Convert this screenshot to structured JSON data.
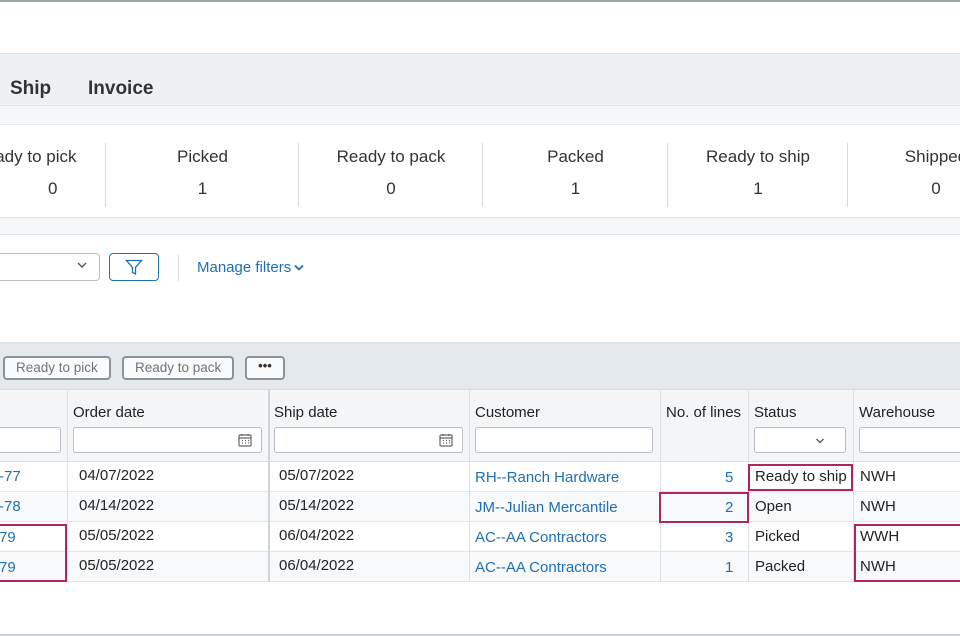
{
  "tabs": [
    "Ship",
    "Invoice"
  ],
  "stats": [
    {
      "label": "Ready to pick",
      "value": "0"
    },
    {
      "label": "Picked",
      "value": "1"
    },
    {
      "label": "Ready to pack",
      "value": "0"
    },
    {
      "label": "Packed",
      "value": "1"
    },
    {
      "label": "Ready to ship",
      "value": "1"
    },
    {
      "label": "Shipped",
      "value": "0"
    }
  ],
  "filters": {
    "manage_label": "Manage filters"
  },
  "actions": {
    "ready_to_pick": "Ready to pick",
    "ready_to_pack": "Ready to pack",
    "more": "•••"
  },
  "columns": {
    "order_date": "Order date",
    "ship_date": "Ship date",
    "customer": "Customer",
    "lines": "No. of lines",
    "status": "Status",
    "warehouse": "Warehouse"
  },
  "rows": [
    {
      "id": "-77",
      "order_date": "04/07/2022",
      "ship_date": "05/07/2022",
      "customer": "RH--Ranch Hardware",
      "lines": "5",
      "status": "Ready to ship",
      "warehouse": "NWH"
    },
    {
      "id": "-78",
      "order_date": "04/14/2022",
      "ship_date": "05/14/2022",
      "customer": "JM--Julian Mercantile",
      "lines": "2",
      "status": "Open",
      "warehouse": "NWH"
    },
    {
      "id": "79",
      "order_date": "05/05/2022",
      "ship_date": "06/04/2022",
      "customer": "AC--AA Contractors",
      "lines": "3",
      "status": "Picked",
      "warehouse": "WWH"
    },
    {
      "id": "79",
      "order_date": "05/05/2022",
      "ship_date": "06/04/2022",
      "customer": "AC--AA Contractors",
      "lines": "1",
      "status": "Packed",
      "warehouse": "NWH"
    }
  ],
  "colors": {
    "link": "#1f6fb2",
    "highlight": "#b0245f"
  }
}
